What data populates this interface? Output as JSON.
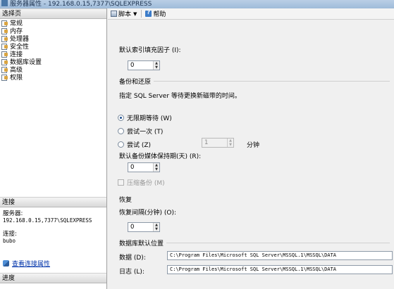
{
  "window": {
    "title": "服务器属性 - 192.168.0.15,7377\\SQLEXPRESS"
  },
  "left_pane": {
    "select_page_header": "选择页",
    "pages": [
      {
        "label": "常规",
        "icon": "page-icon"
      },
      {
        "label": "内存",
        "icon": "page-icon"
      },
      {
        "label": "处理器",
        "icon": "page-icon"
      },
      {
        "label": "安全性",
        "icon": "page-icon"
      },
      {
        "label": "连接",
        "icon": "page-icon"
      },
      {
        "label": "数据库设置",
        "icon": "page-icon"
      },
      {
        "label": "高级",
        "icon": "page-icon"
      },
      {
        "label": "权限",
        "icon": "page-icon"
      }
    ],
    "connection_header": "连接",
    "server_label": "服务器:",
    "server_value": "192.168.0.15,7377\\SQLEXPRESS",
    "connection_label": "连接:",
    "connection_value": "bubo",
    "view_connection_link": "查看连接属性",
    "progress_header": "进度"
  },
  "toolbar": {
    "script_label": "脚本",
    "help_label": "帮助"
  },
  "settings": {
    "fill_factor_label": "默认索引填充因子 (I):",
    "fill_factor_value": "0",
    "backup_group": "备份和还原",
    "tape_hint": "指定 SQL Server 等待更换新磁带的时间。",
    "radio_indefinite": "无限期等待 (W)",
    "radio_once": "尝试一次 (T)",
    "radio_try": "尝试 (Z)",
    "try_minutes_value": "1",
    "minutes_unit": "分钟",
    "retention_label": "默认备份媒体保持期(天) (R):",
    "retention_value": "0",
    "compress_label": "压缩备份 (M)",
    "recovery_group": "恢复",
    "recovery_interval_label": "恢复间隔(分钟) (O):",
    "recovery_interval_value": "0",
    "db_default_locations_group": "数据库默认位置",
    "data_label": "数据 (D):",
    "data_path": "C:\\Program Files\\Microsoft SQL Server\\MSSQL.1\\MSSQL\\DATA",
    "log_label": "日志 (L):",
    "log_path": "C:\\Program Files\\Microsoft SQL Server\\MSSQL.1\\MSSQL\\DATA"
  }
}
